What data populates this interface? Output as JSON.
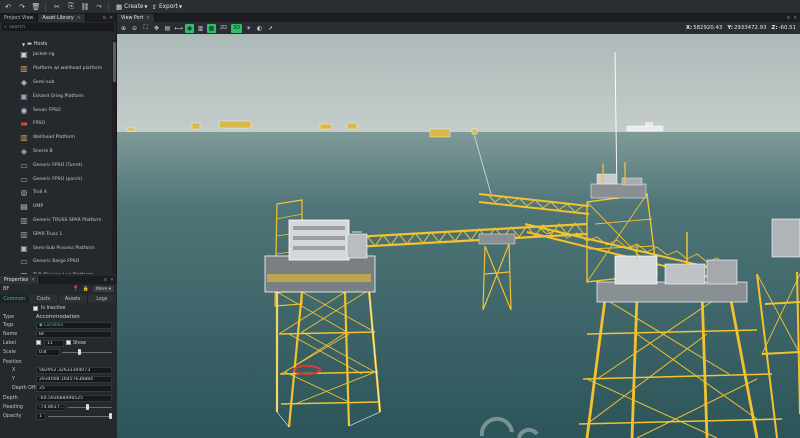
{
  "toolbar": {
    "create_label": "Create",
    "export_label": "Export"
  },
  "left_tabs": {
    "project_view": "Project View",
    "asset_library": "Asset Library"
  },
  "search": {
    "placeholder": "Search"
  },
  "asset_group": {
    "label": "Hosts"
  },
  "assets": [
    "Jacket-rig",
    "Platform w/ wellhead platform",
    "Semi-sub",
    "Edvard Grieg Platform",
    "Sevan FPSO",
    "FPSO",
    "Wellhead Platform",
    "Snorre B",
    "Generic FPSO (Turret)",
    "Generic FPSO (porch)",
    "Troll A",
    "UMP",
    "Generic TRUSS SPAR Platform",
    "SPAR Truss 1",
    "Semi-Sub Process Platform",
    "Generic Barge FPSO",
    "TLP (Tension Leg Platform)"
  ],
  "properties": {
    "header": "Properties",
    "object_name": "BF",
    "more_label": "More",
    "tabs": [
      "Common",
      "Costs",
      "Assets",
      "Logs"
    ],
    "is_inactive": "Is Inactive",
    "type_label": "Type",
    "type_value": "Accommodation",
    "tags_label": "Tags",
    "tags_value": "Location",
    "name_label": "Name",
    "name_value": "BF",
    "label_label": "Label",
    "label_value": "11",
    "show_label": "Show",
    "scale_label": "Scale",
    "scale_value": "0.8",
    "scale_level": 0.35,
    "position_label": "Position",
    "x_label": "X",
    "x_value": "582952.32633304073",
    "y_label": "Y",
    "y_value": "2934008.16457636884",
    "depth_offset_label": "Depth Offset",
    "depth_offset_value": "25",
    "depth_label": "Depth",
    "depth_value": "-60.593688496525",
    "heading_label": "Heading",
    "heading_value": "-74.8617...",
    "heading_level": 0.45,
    "opacity_label": "Opacity",
    "opacity_value": "1",
    "opacity_level": 1.0
  },
  "viewport": {
    "tab": "View Port",
    "mode_2d": "2D",
    "mode_3d": "3D",
    "coords": {
      "x_label": "X:",
      "x": "582920.43",
      "y_label": "Y:",
      "y": "2933472.93",
      "z_label": "Z:",
      "z": "-60.51"
    }
  },
  "colors": {
    "accent_green": "#2fbf6a",
    "jacket_yellow": "#f2c230",
    "sea": "#3d6b6f",
    "sky": "#b8c4c4"
  }
}
